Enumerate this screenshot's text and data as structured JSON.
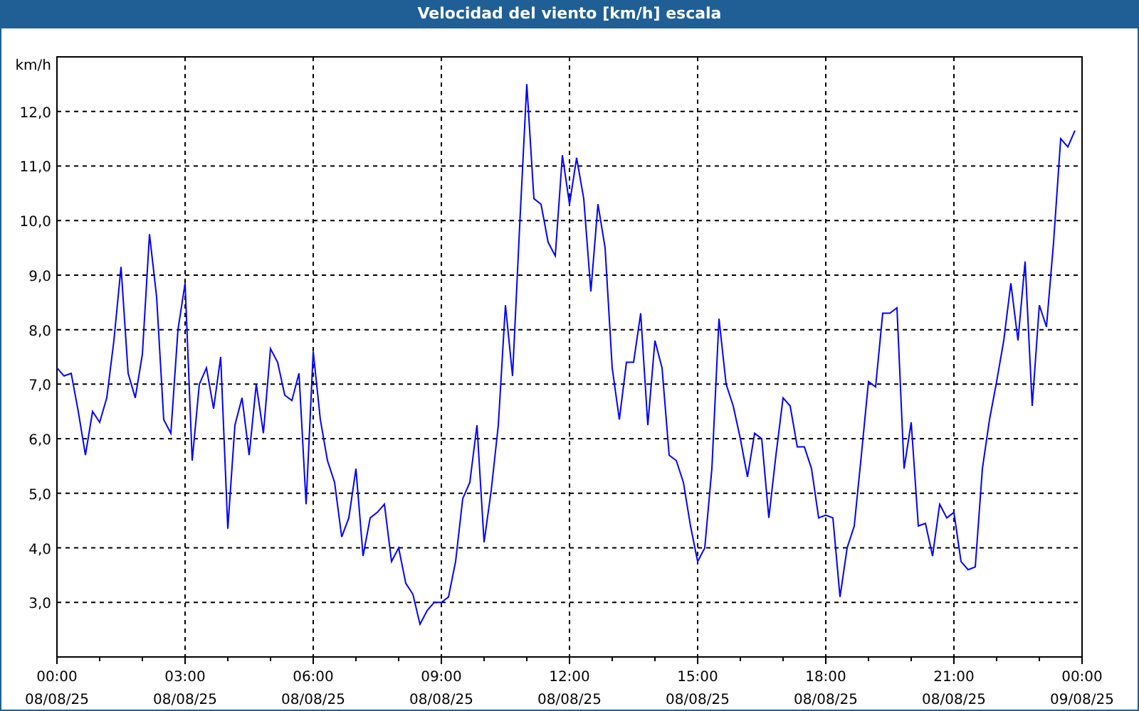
{
  "window": {
    "title": "Velocidad del viento [km/h] escala"
  },
  "chart": {
    "chart_data": {
      "type": "line",
      "grid": true,
      "ylabel": "km/h",
      "ylim": [
        2,
        13
      ],
      "yticks": [
        {
          "value": 3,
          "label": "3,0"
        },
        {
          "value": 4,
          "label": "4,0"
        },
        {
          "value": 5,
          "label": "5,0"
        },
        {
          "value": 6,
          "label": "6,0"
        },
        {
          "value": 7,
          "label": "7,0"
        },
        {
          "value": 8,
          "label": "8,0"
        },
        {
          "value": 9,
          "label": "9,0"
        },
        {
          "value": 10,
          "label": "10,0"
        },
        {
          "value": 11,
          "label": "11,0"
        },
        {
          "value": 12,
          "label": "12,0"
        }
      ],
      "categories": [
        "00:00\n08/08/25",
        null,
        null,
        null,
        null,
        null,
        null,
        null,
        null,
        null,
        null,
        null,
        null,
        null,
        null,
        null,
        null,
        null,
        "03:00\n08/08/25",
        null,
        null,
        null,
        null,
        null,
        null,
        null,
        null,
        null,
        null,
        null,
        null,
        null,
        null,
        null,
        null,
        null,
        "06:00\n08/08/25",
        null,
        null,
        null,
        null,
        null,
        null,
        null,
        null,
        null,
        null,
        null,
        null,
        null,
        null,
        null,
        null,
        null,
        "09:00\n08/08/25",
        null,
        null,
        null,
        null,
        null,
        null,
        null,
        null,
        null,
        null,
        null,
        null,
        null,
        null,
        null,
        null,
        null,
        "12:00\n08/08/25",
        null,
        null,
        null,
        null,
        null,
        null,
        null,
        null,
        null,
        null,
        null,
        null,
        null,
        null,
        null,
        null,
        null,
        "15:00\n08/08/25",
        null,
        null,
        null,
        null,
        null,
        null,
        null,
        null,
        null,
        null,
        null,
        null,
        null,
        null,
        null,
        null,
        null,
        "18:00\n08/08/25",
        null,
        null,
        null,
        null,
        null,
        null,
        null,
        null,
        null,
        null,
        null,
        null,
        null,
        null,
        null,
        null,
        null,
        "21:00\n08/08/25",
        null,
        null,
        null,
        null,
        null,
        null,
        null,
        null,
        null,
        null,
        null,
        null,
        null,
        null,
        null,
        null,
        null,
        "00:00\n09/08/25"
      ],
      "series": [
        {
          "color": "#0000ff",
          "values": [
            7.3,
            7.15,
            7.2,
            6.5,
            5.7,
            6.5,
            6.3,
            6.75,
            7.8,
            9.15,
            7.2,
            6.75,
            7.55,
            9.75,
            8.6,
            6.35,
            6.1,
            8.0,
            8.85,
            5.6,
            7.0,
            7.3,
            6.55,
            7.5,
            4.35,
            6.25,
            6.75,
            5.7,
            7.0,
            6.1,
            7.65,
            7.4,
            6.8,
            6.7,
            7.2,
            4.8,
            7.6,
            6.35,
            5.6,
            5.2,
            4.2,
            4.55,
            5.45,
            3.85,
            4.55,
            4.65,
            4.8,
            3.75,
            4.0,
            3.35,
            3.15,
            2.6,
            2.85,
            3.0,
            3.0,
            3.1,
            3.75,
            4.9,
            5.2,
            6.25,
            4.1,
            5.05,
            6.25,
            8.45,
            7.15,
            9.9,
            12.5,
            10.4,
            10.3,
            9.6,
            9.35,
            11.2,
            10.3,
            11.15,
            10.4,
            8.7,
            10.3,
            9.5,
            7.3,
            6.35,
            7.4,
            7.4,
            8.3,
            6.25,
            7.8,
            7.3,
            5.7,
            5.6,
            5.2,
            4.4,
            3.75,
            4.0,
            5.45,
            8.2,
            7.0,
            6.6,
            6.0,
            5.3,
            6.1,
            6.0,
            4.55,
            5.7,
            6.75,
            6.6,
            5.85,
            5.85,
            5.45,
            4.55,
            4.6,
            4.55,
            3.1,
            4.0,
            4.4,
            5.7,
            7.05,
            6.95,
            8.3,
            8.3,
            8.4,
            5.45,
            6.3,
            4.4,
            4.45,
            3.85,
            4.8,
            4.55,
            4.65,
            3.75,
            3.6,
            3.65,
            5.45,
            6.35,
            7.05,
            7.8,
            8.85,
            7.8,
            9.25,
            6.6,
            8.45,
            8.05,
            9.6,
            11.5,
            11.35,
            11.65,
            null
          ]
        }
      ]
    }
  }
}
